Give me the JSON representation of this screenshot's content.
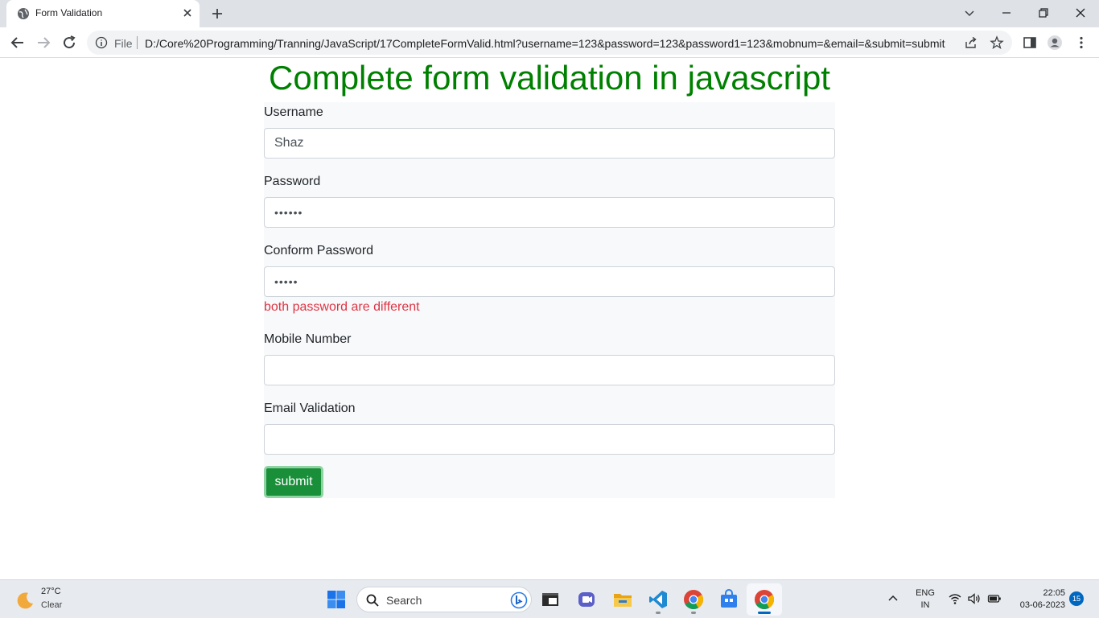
{
  "browser": {
    "tab_title": "Form Validation",
    "file_label": "File",
    "url": "D:/Core%20Programming/Tranning/JavaScript/17CompleteFormValid.html?username=123&password=123&password1=123&mobnum=&email=&submit=submit"
  },
  "page": {
    "heading": "Complete form validation in javascript",
    "form": {
      "username_label": "Username",
      "username_value": "Shaz",
      "password_label": "Password",
      "password_value": "••••••",
      "confirm_label": "Conform Password",
      "confirm_value": "•••••",
      "confirm_error": "both password are different",
      "mobile_label": "Mobile Number",
      "mobile_value": "",
      "email_label": "Email Validation",
      "email_value": "",
      "submit_label": "submit"
    },
    "colors": {
      "heading": "#008000",
      "error": "#dc3545",
      "submit": "#198f3a"
    }
  },
  "taskbar": {
    "weather_temp": "27°C",
    "weather_condition": "Clear",
    "search_label": "Search",
    "lang_line1": "ENG",
    "lang_line2": "IN",
    "time": "22:05",
    "date": "03-06-2023",
    "notification_count": "15",
    "apps": [
      "start-icon",
      "search-icon",
      "bing-icon",
      "terminal-icon",
      "teams-icon",
      "file-explorer-icon",
      "vscode-icon",
      "chrome-icon",
      "store-icon",
      "chrome-icon"
    ]
  }
}
